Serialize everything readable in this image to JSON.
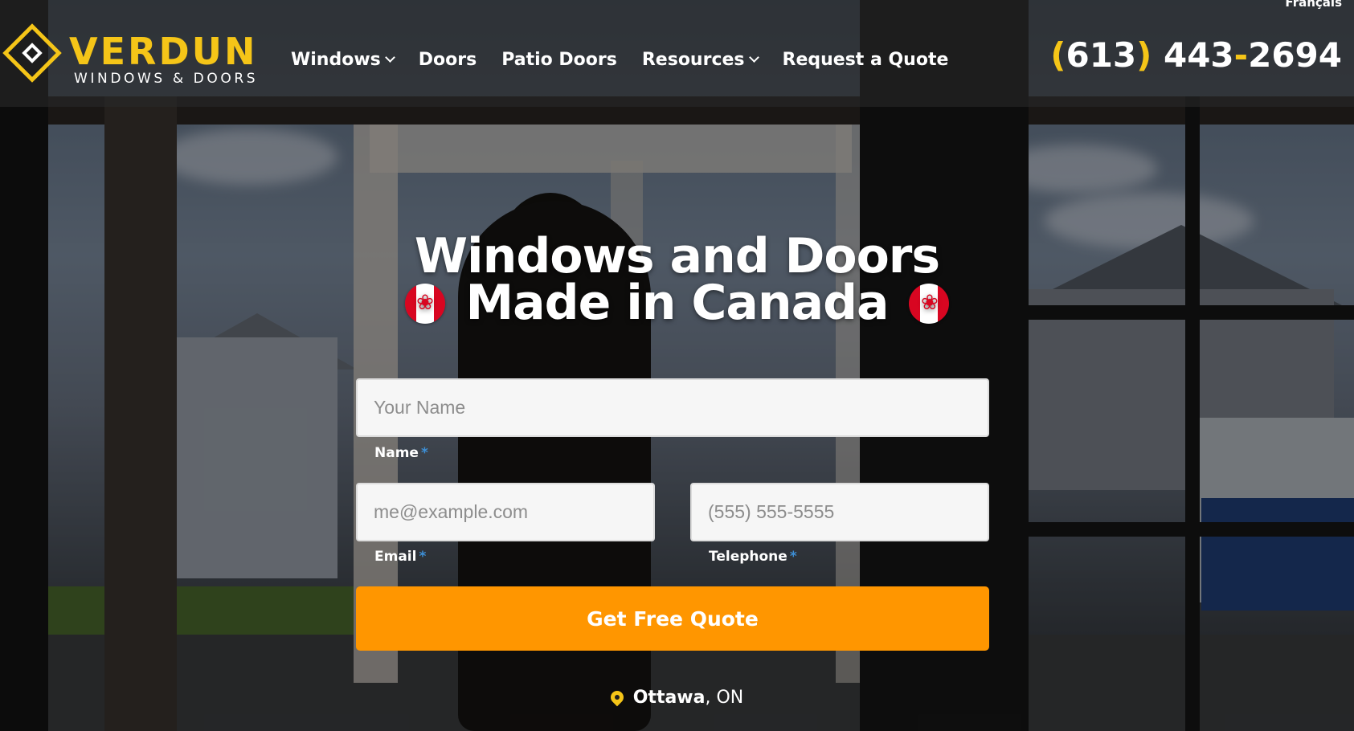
{
  "header": {
    "language_link": "Français",
    "logo": {
      "name": "VERDUN",
      "tagline": "WINDOWS & DOORS"
    },
    "nav": [
      {
        "label": "Windows",
        "has_dropdown": true
      },
      {
        "label": "Doors",
        "has_dropdown": false
      },
      {
        "label": "Patio Doors",
        "has_dropdown": false
      },
      {
        "label": "Resources",
        "has_dropdown": true
      },
      {
        "label": "Request a Quote",
        "has_dropdown": false
      }
    ],
    "phone": {
      "open": "(",
      "area": "613",
      "close": ")",
      "mid": " 443",
      "dash": "-",
      "last": "2694"
    }
  },
  "hero": {
    "line1": "Windows and Doors",
    "line2": "Made in Canada",
    "flag_icon": "canada-flag-icon"
  },
  "form": {
    "name": {
      "placeholder": "Your Name",
      "value": "",
      "label": "Name",
      "required_mark": "*"
    },
    "email": {
      "placeholder": "me@example.com",
      "value": "",
      "label": "Email",
      "required_mark": "*"
    },
    "telephone": {
      "placeholder": "(555) 555-5555",
      "value": "",
      "label": "Telephone",
      "required_mark": "*"
    },
    "submit_label": "Get Free Quote"
  },
  "location": {
    "city": "Ottawa",
    "sep": ",",
    "province": "ON",
    "icon": "map-pin-icon"
  },
  "colors": {
    "accent_yellow": "#f5c518",
    "button_orange": "#ff9600",
    "required_blue": "#3d8fd6"
  }
}
